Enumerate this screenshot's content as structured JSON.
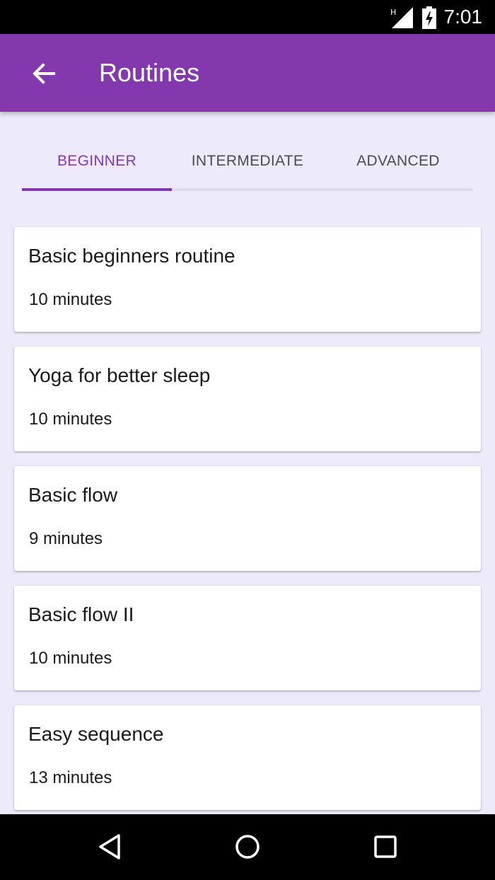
{
  "status_bar": {
    "time": "7:01",
    "signal_icon": "signal-icon",
    "network_type": "H",
    "battery_icon": "battery-charging-icon"
  },
  "app_bar": {
    "title": "Routines",
    "back_icon": "arrow-back-icon",
    "color": "#8438AE"
  },
  "tabs": [
    {
      "label": "BEGINNER",
      "active": true
    },
    {
      "label": "INTERMEDIATE",
      "active": false
    },
    {
      "label": "ADVANCED",
      "active": false
    }
  ],
  "routines": [
    {
      "title": "Basic beginners routine",
      "duration": "10 minutes"
    },
    {
      "title": "Yoga for better sleep",
      "duration": "10 minutes"
    },
    {
      "title": "Basic flow",
      "duration": "9 minutes"
    },
    {
      "title": "Basic flow II",
      "duration": "10 minutes"
    },
    {
      "title": "Easy sequence",
      "duration": "13 minutes"
    }
  ],
  "nav_bar": {
    "back_icon": "nav-back-icon",
    "home_icon": "nav-home-icon",
    "recents_icon": "nav-recents-icon"
  },
  "colors": {
    "accent": "#8438AE",
    "background": "#EDEBFB",
    "card": "#FFFFFF"
  }
}
